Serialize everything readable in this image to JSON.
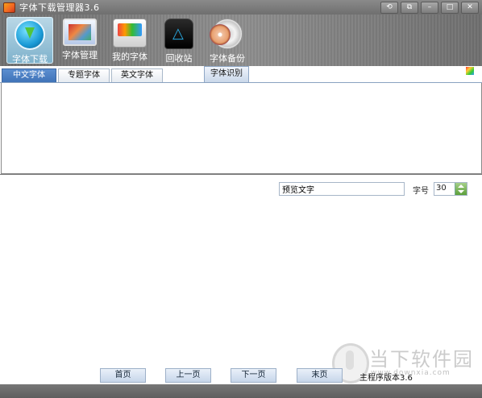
{
  "window": {
    "title": "字体下载管理器3.6",
    "controls": [
      "⟲",
      "⧉",
      "–",
      "□",
      "✕"
    ]
  },
  "toolbar": {
    "items": [
      {
        "label": "字体下载",
        "icon": "download-icon",
        "active": true
      },
      {
        "label": "字体管理",
        "icon": "font-manage-icon",
        "active": false
      },
      {
        "label": "我的字体",
        "icon": "my-fonts-icon",
        "active": false
      },
      {
        "label": "回收站",
        "icon": "recycle-bin-icon",
        "active": false
      },
      {
        "label": "字体备份",
        "icon": "backup-disc-icon",
        "active": false
      }
    ],
    "palette_icon": "palette-icon"
  },
  "tabs": {
    "items": [
      {
        "label": "中文字体",
        "active": true
      },
      {
        "label": "专题字体",
        "active": false
      },
      {
        "label": "英文字体",
        "active": false
      }
    ],
    "identify_label": "字体识别"
  },
  "preview": {
    "text_value": "预览文字",
    "size_label": "字号",
    "size_value": "30"
  },
  "pagination": {
    "first": "首页",
    "prev": "上一页",
    "next": "下一页",
    "last": "末页",
    "version_text": "主程序版本3.6"
  },
  "watermark": {
    "cn": "当下软件园",
    "en": "www.downxia.com"
  },
  "colors": {
    "active_tab": "#4a7ec2",
    "toolbar_bg": "#7f7f7f",
    "active_tool_bg": "#9ec6da"
  }
}
